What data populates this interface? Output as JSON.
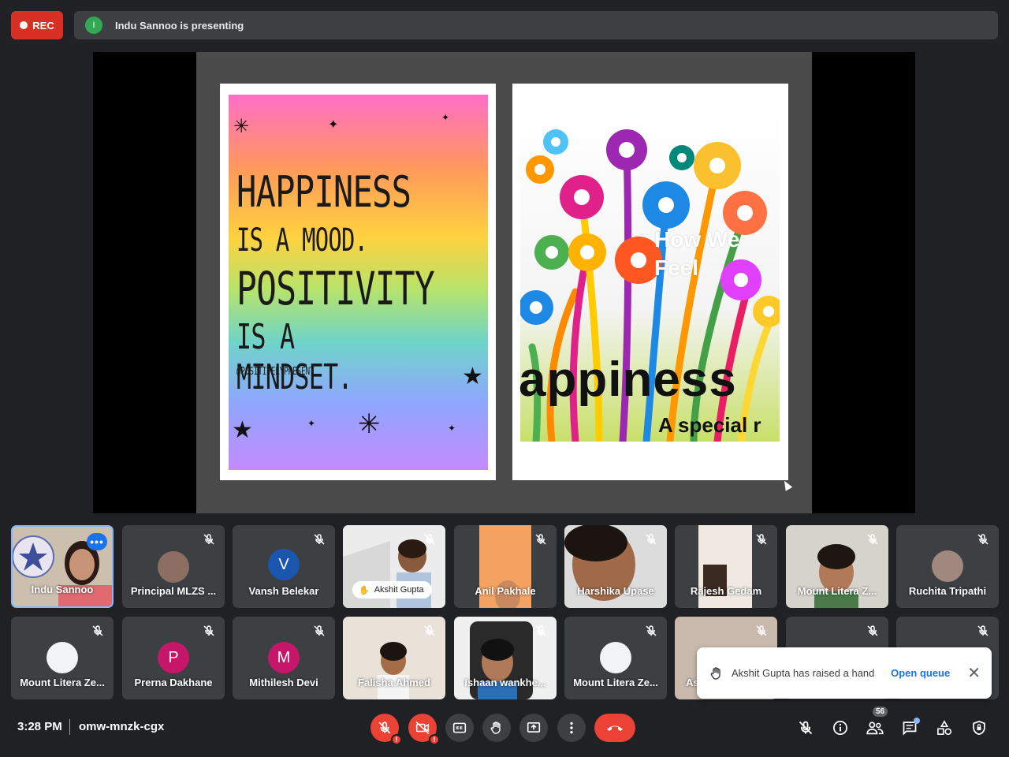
{
  "top": {
    "rec_label": "REC",
    "presenter_initial": "I",
    "presenting_text": "Indu Sannoo is presenting"
  },
  "slide": {
    "left_card": {
      "lines": [
        "HAPPINESS",
        "IS A MOOD.",
        "POSITIVITY",
        "IS A MINDSET.",
        "@POSITIVELYPRESENT"
      ]
    },
    "right_card": {
      "overlay_line1": "How We",
      "overlay_line2": "Feel",
      "big_text": "appiness",
      "sub_text": "A special r"
    }
  },
  "participants": [
    {
      "name": "Indu Sannoo",
      "more": "•••"
    },
    {
      "name": "Principal MLZS ..."
    },
    {
      "name": "Vansh Belekar",
      "initial": "V",
      "color": "#1a56b0"
    },
    {
      "name": "Akshit Gupta"
    },
    {
      "name": "Anil Pakhale"
    },
    {
      "name": "Harshika Upase"
    },
    {
      "name": "Rajesh Gedam"
    },
    {
      "name": "Mount Litera Z..."
    },
    {
      "name": "Ruchita Tripathi"
    },
    {
      "name": "Mount Litera Ze..."
    },
    {
      "name": "Prerna Dakhane",
      "initial": "P",
      "color": "#c5166a"
    },
    {
      "name": "Mithilesh Devi",
      "initial": "M",
      "color": "#c5166a"
    },
    {
      "name": "Falisha Ahmed"
    },
    {
      "name": "Ishaan wankhe..."
    },
    {
      "name": "Mount Litera Ze..."
    },
    {
      "name": "As"
    }
  ],
  "toast": {
    "message": "Akshit Gupta has raised a hand",
    "action": "Open queue"
  },
  "bottom": {
    "time": "3:28 PM",
    "meeting_code": "omw-mnzk-cgx",
    "people_count": "56",
    "controls": [
      "mic-off-icon",
      "camera-off-icon",
      "captions-icon",
      "raise-hand-icon",
      "present-icon",
      "more-options-icon",
      "end-call-icon"
    ],
    "right_controls": [
      "mic-off-icon",
      "info-icon",
      "people-icon",
      "chat-icon",
      "activities-icon",
      "host-controls-icon"
    ]
  },
  "colors": {
    "background": "#202124",
    "rec": "#d93025",
    "accent": "#1a73e8",
    "end_call": "#ea4335"
  }
}
